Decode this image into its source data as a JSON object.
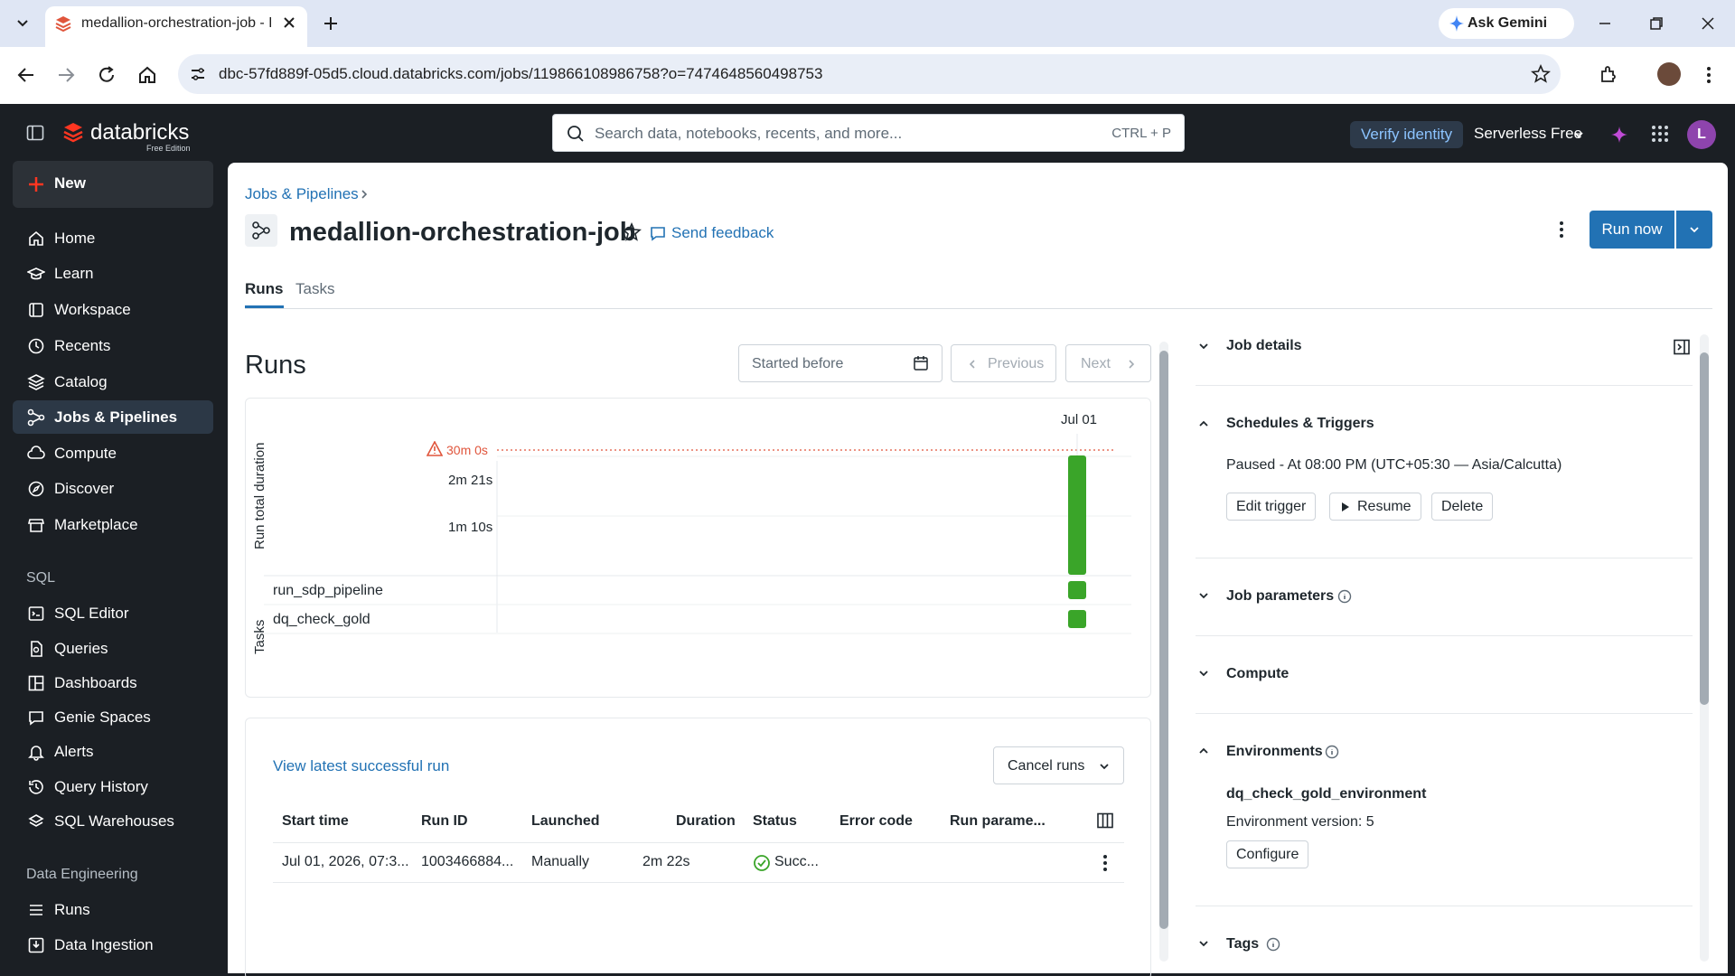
{
  "browser": {
    "tab_title": "medallion-orchestration-job - D",
    "url": "dbc-57fd889f-05d5.cloud.databricks.com/jobs/119866108986758?o=7474648560498753",
    "gemini_label": "Ask Gemini"
  },
  "header": {
    "brand": "databricks",
    "edition": "Free Edition",
    "search_placeholder": "Search data, notebooks, recents, and more...",
    "search_shortcut": "CTRL + P",
    "verify_identity": "Verify identity",
    "workspace": "Serverless Free",
    "avatar_initial": "L"
  },
  "sidebar": {
    "new_label": "New",
    "items": [
      {
        "label": "Home"
      },
      {
        "label": "Learn"
      },
      {
        "label": "Workspace"
      },
      {
        "label": "Recents"
      },
      {
        "label": "Catalog"
      },
      {
        "label": "Jobs & Pipelines"
      },
      {
        "label": "Compute"
      },
      {
        "label": "Discover"
      },
      {
        "label": "Marketplace"
      }
    ],
    "sql_section": "SQL",
    "sql_items": [
      {
        "label": "SQL Editor"
      },
      {
        "label": "Queries"
      },
      {
        "label": "Dashboards"
      },
      {
        "label": "Genie Spaces"
      },
      {
        "label": "Alerts"
      },
      {
        "label": "Query History"
      },
      {
        "label": "SQL Warehouses"
      }
    ],
    "de_section": "Data Engineering",
    "de_items": [
      {
        "label": "Runs"
      },
      {
        "label": "Data Ingestion"
      }
    ]
  },
  "job": {
    "breadcrumb": "Jobs & Pipelines",
    "title": "medallion-orchestration-job",
    "send_feedback": "Send feedback",
    "run_now": "Run now",
    "tabs": [
      {
        "label": "Runs"
      },
      {
        "label": "Tasks"
      }
    ]
  },
  "runs": {
    "heading": "Runs",
    "started_before": "Started before",
    "previous": "Previous",
    "next": "Next",
    "view_latest": "View latest successful run",
    "cancel_runs": "Cancel runs",
    "columns": [
      "Start time",
      "Run ID",
      "Launched",
      "Duration",
      "Status",
      "Error code",
      "Run parame..."
    ],
    "rows": [
      {
        "start_time": "Jul 01, 2026, 07:3...",
        "run_id": "1003466884...",
        "launched": "Manually",
        "duration": "2m 22s",
        "status": "Succ...",
        "error_code": "",
        "run_params": ""
      }
    ]
  },
  "chart_data": {
    "type": "bar",
    "ylabel": "Run total duration",
    "categories": [
      "Jul 01"
    ],
    "yticks": [
      "2m 21s",
      "1m 10s"
    ],
    "threshold_label": "30m 0s",
    "series": [
      {
        "values": [
          142
        ]
      }
    ],
    "ylim_seconds": [
      0,
      170
    ],
    "tasks_label": "Tasks",
    "tasks": [
      {
        "name": "run_sdp_pipeline",
        "status": "success"
      },
      {
        "name": "dq_check_gold",
        "status": "success"
      }
    ],
    "colors": {
      "success": "#3aa529",
      "threshold": "#e0553c"
    }
  },
  "details": {
    "job_details": "Job details",
    "schedules": "Schedules & Triggers",
    "schedule_text": "Paused - At 08:00 PM (UTC+05:30 — Asia/Calcutta)",
    "edit_trigger": "Edit trigger",
    "resume": "Resume",
    "delete": "Delete",
    "job_parameters": "Job parameters",
    "compute": "Compute",
    "environments": "Environments",
    "env_name": "dq_check_gold_environment",
    "env_version": "Environment version: 5",
    "configure": "Configure",
    "tags": "Tags"
  }
}
